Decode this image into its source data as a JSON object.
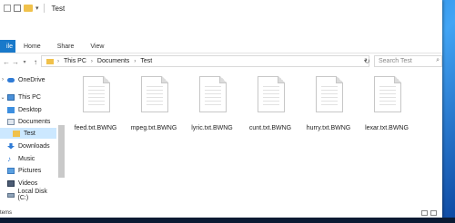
{
  "window": {
    "title": "Test"
  },
  "ribbon": {
    "tabs": [
      {
        "label": "ile"
      },
      {
        "label": "Home"
      },
      {
        "label": "Share"
      },
      {
        "label": "View"
      }
    ]
  },
  "nav": {
    "breadcrumb": [
      "This PC",
      "Documents",
      "Test"
    ],
    "search_placeholder": "Search Test"
  },
  "sidebar": {
    "items": [
      {
        "label": "OneDrive",
        "icon": "cloud-icon"
      },
      {
        "label": "This PC",
        "icon": "computer-icon"
      },
      {
        "label": "Desktop",
        "icon": "desktop-icon"
      },
      {
        "label": "Documents",
        "icon": "documents-icon"
      },
      {
        "label": "Test",
        "icon": "folder-icon",
        "selected": true
      },
      {
        "label": "Downloads",
        "icon": "download-icon"
      },
      {
        "label": "Music",
        "icon": "music-icon"
      },
      {
        "label": "Pictures",
        "icon": "pictures-icon"
      },
      {
        "label": "Videos",
        "icon": "videos-icon"
      },
      {
        "label": "Local Disk (C:)",
        "icon": "disk-icon"
      }
    ]
  },
  "files": [
    {
      "name": "feed.txt.BWNG"
    },
    {
      "name": "mpeg.txt.BWNG"
    },
    {
      "name": "lyric.txt.BWNG"
    },
    {
      "name": "cunt.txt.BWNG"
    },
    {
      "name": "hurry.txt.BWNG"
    },
    {
      "name": "lexar.txt.BWNG"
    }
  ],
  "status": {
    "text": "tems"
  },
  "colors": {
    "accent": "#1979ca",
    "selection": "#cce8ff",
    "folder": "#f0c14b"
  }
}
